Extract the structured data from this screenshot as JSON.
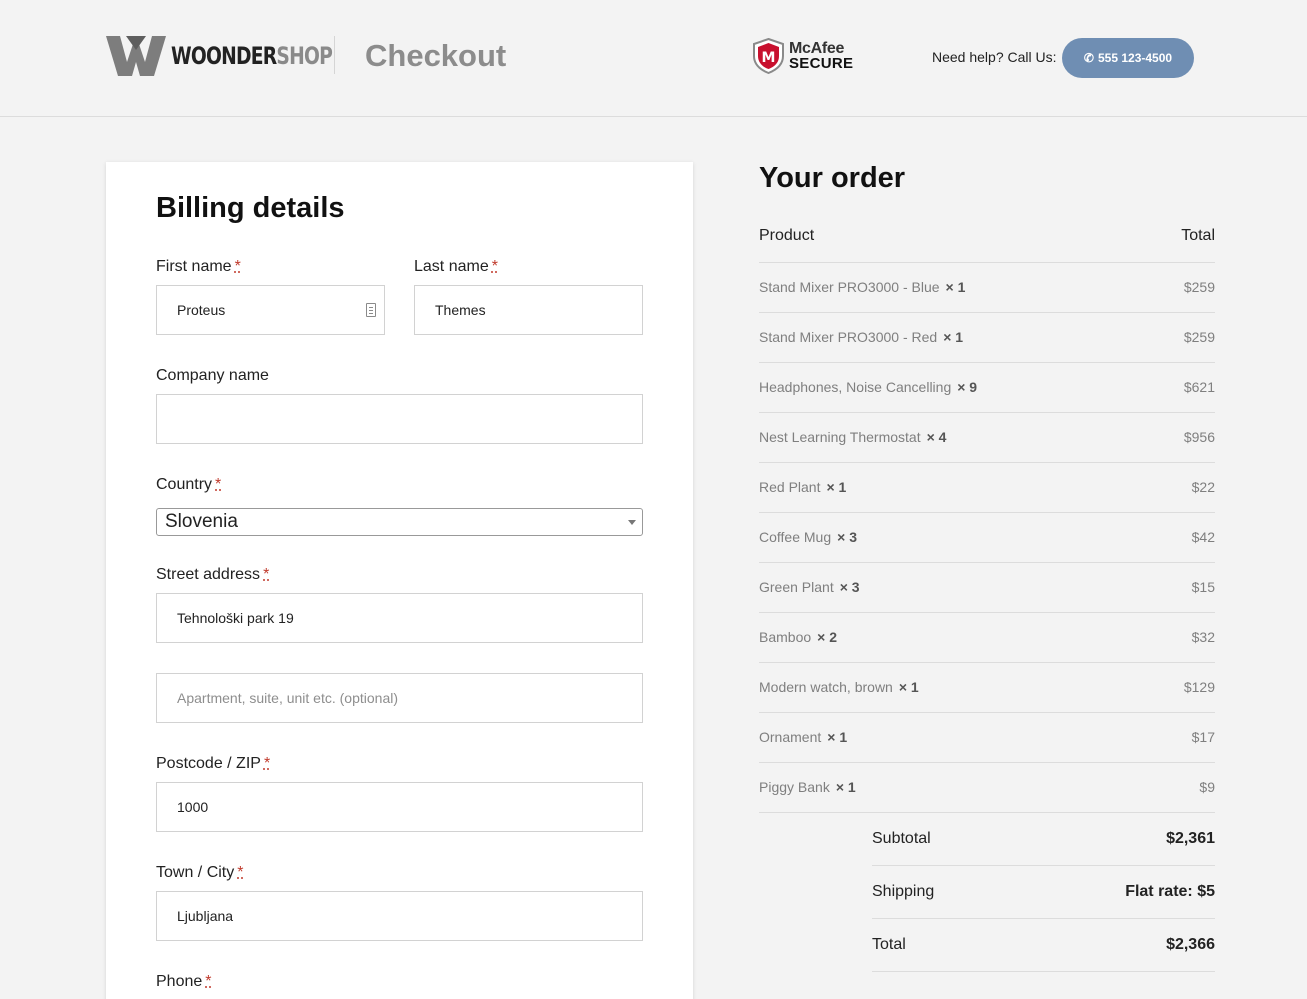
{
  "header": {
    "brand_primary": "WOONDER",
    "brand_secondary": "SHOP",
    "page_title": "Checkout",
    "badge_name": "McAfee",
    "badge_secure": "SECURE",
    "help_text": "Need help? Call Us:",
    "phone_label": "555 123-4500",
    "phone_icon": "phone-icon",
    "accent_color": "#6f8eb3"
  },
  "billing": {
    "title": "Billing details",
    "required_mark": "*",
    "first_name": {
      "label": "First name",
      "value": "Proteus"
    },
    "last_name": {
      "label": "Last name",
      "value": "Themes"
    },
    "company": {
      "label": "Company name",
      "value": ""
    },
    "country": {
      "label": "Country",
      "value": "Slovenia"
    },
    "street": {
      "label": "Street address",
      "value": "Tehnološki park 19"
    },
    "apartment": {
      "placeholder": "Apartment, suite, unit etc. (optional)"
    },
    "postcode": {
      "label": "Postcode / ZIP",
      "value": "1000"
    },
    "city": {
      "label": "Town / City",
      "value": "Ljubljana"
    },
    "phone": {
      "label": "Phone"
    }
  },
  "order": {
    "title": "Your order",
    "col_product": "Product",
    "col_total": "Total",
    "items": [
      {
        "name": "Stand Mixer PRO3000 - Blue",
        "qty": "× 1",
        "total": "$259"
      },
      {
        "name": "Stand Mixer PRO3000 - Red",
        "qty": "× 1",
        "total": "$259"
      },
      {
        "name": "Headphones, Noise Cancelling",
        "qty": "× 9",
        "total": "$621"
      },
      {
        "name": "Nest Learning Thermostat",
        "qty": "× 4",
        "total": "$956"
      },
      {
        "name": "Red Plant",
        "qty": "× 1",
        "total": "$22"
      },
      {
        "name": "Coffee Mug",
        "qty": "× 3",
        "total": "$42"
      },
      {
        "name": "Green Plant",
        "qty": "× 3",
        "total": "$15"
      },
      {
        "name": "Bamboo",
        "qty": "× 2",
        "total": "$32"
      },
      {
        "name": "Modern watch, brown",
        "qty": "× 1",
        "total": "$129"
      },
      {
        "name": "Ornament",
        "qty": "× 1",
        "total": "$17"
      },
      {
        "name": "Piggy Bank",
        "qty": "× 1",
        "total": "$9"
      }
    ],
    "subtotal": {
      "label": "Subtotal",
      "value": "$2,361"
    },
    "shipping": {
      "label": "Shipping",
      "value": "Flat rate: $5"
    },
    "total": {
      "label": "Total",
      "value": "$2,366"
    }
  }
}
